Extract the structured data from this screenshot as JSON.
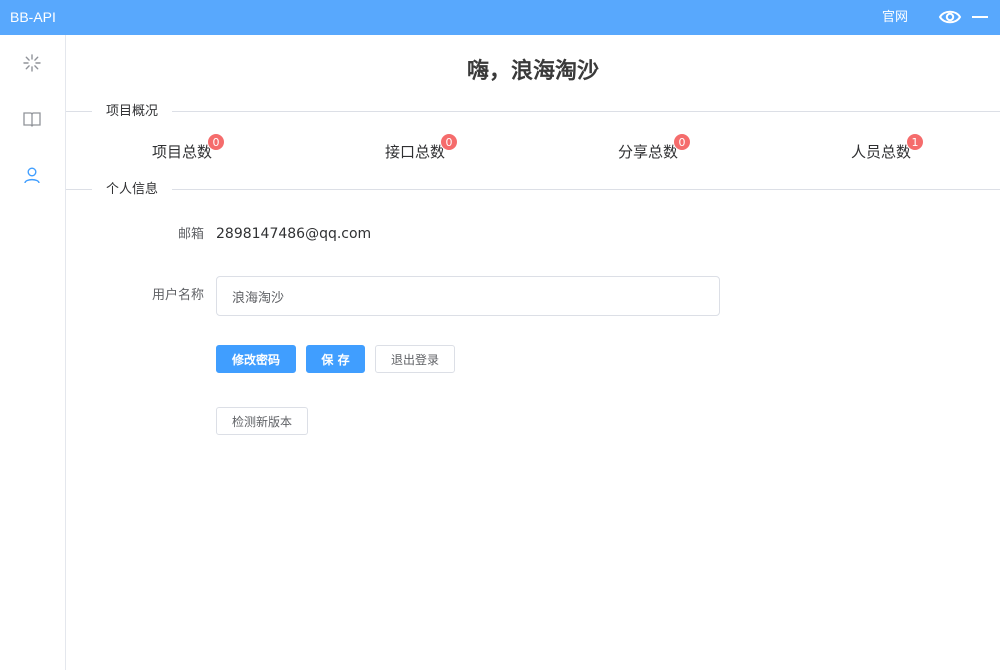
{
  "app": {
    "title": "BB-API"
  },
  "topbar": {
    "link_label": "官网"
  },
  "greeting": "嗨，浪海淘沙",
  "sections": {
    "overview": "项目概况",
    "personal": "个人信息"
  },
  "stats": [
    {
      "label": "项目总数",
      "count": "0"
    },
    {
      "label": "接口总数",
      "count": "0"
    },
    {
      "label": "分享总数",
      "count": "0"
    },
    {
      "label": "人员总数",
      "count": "1"
    }
  ],
  "profile": {
    "email_label": "邮箱",
    "email_value": "2898147486@qq.com",
    "username_label": "用户名称",
    "username_value": "浪海淘沙"
  },
  "buttons": {
    "change_password": "修改密码",
    "save": "保 存",
    "logout": "退出登录",
    "check_version": "检测新版本"
  },
  "colors": {
    "topbar": "#58a8fd",
    "primary": "#409eff",
    "badge": "#f56c6c",
    "active_icon": "#409eff"
  }
}
